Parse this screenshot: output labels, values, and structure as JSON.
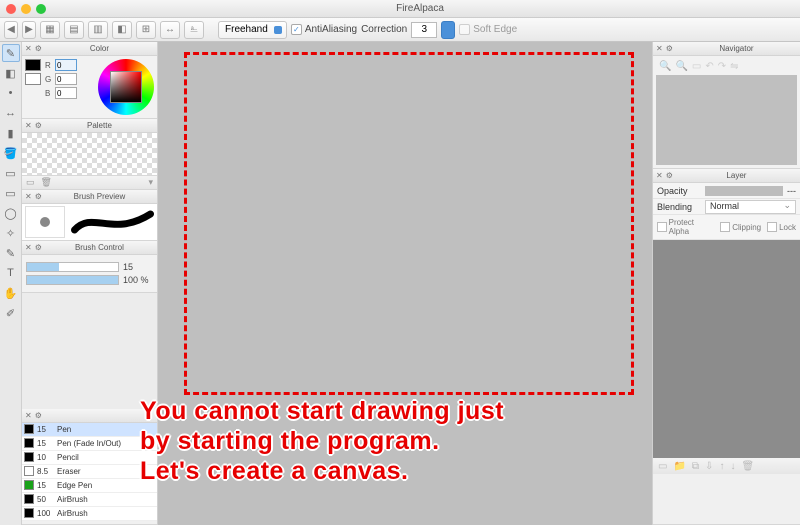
{
  "window": {
    "title": "FireAlpaca"
  },
  "toolbar": {
    "mode": "Freehand",
    "antialias_label": "AntiAliasing",
    "antialias_checked": "✓",
    "correction_label": "Correction",
    "correction_value": "3",
    "softedge_label": "Soft Edge"
  },
  "panels": {
    "color": {
      "title": "Color",
      "r_label": "R",
      "r_value": "0",
      "g_label": "G",
      "g_value": "0",
      "b_label": "B",
      "b_value": "0"
    },
    "palette": {
      "title": "Palette"
    },
    "brush_preview": {
      "title": "Brush Preview"
    },
    "brush_control": {
      "title": "Brush Control",
      "size_value": "15",
      "opacity_value": "100 %"
    },
    "brush_list": {
      "items": [
        {
          "size": "15",
          "name": "Pen",
          "color": "#000"
        },
        {
          "size": "15",
          "name": "Pen (Fade In/Out)",
          "color": "#000"
        },
        {
          "size": "10",
          "name": "Pencil",
          "color": "#000"
        },
        {
          "size": "8.5",
          "name": "Eraser",
          "color": "#fff"
        },
        {
          "size": "15",
          "name": "Edge Pen",
          "color": "#1aa21a"
        },
        {
          "size": "50",
          "name": "AirBrush",
          "color": "#000"
        },
        {
          "size": "100",
          "name": "AirBrush",
          "color": "#000"
        }
      ]
    },
    "navigator": {
      "title": "Navigator"
    },
    "layer": {
      "title": "Layer",
      "opacity_label": "Opacity",
      "opacity_value": "---",
      "blending_label": "Blending",
      "blending_value": "Normal",
      "protect_label": "Protect Alpha",
      "clipping_label": "Clipping",
      "lock_label": "Lock"
    }
  },
  "overlay": {
    "text": "You cannot start drawing just\nby starting the program.\nLet's create a canvas."
  }
}
